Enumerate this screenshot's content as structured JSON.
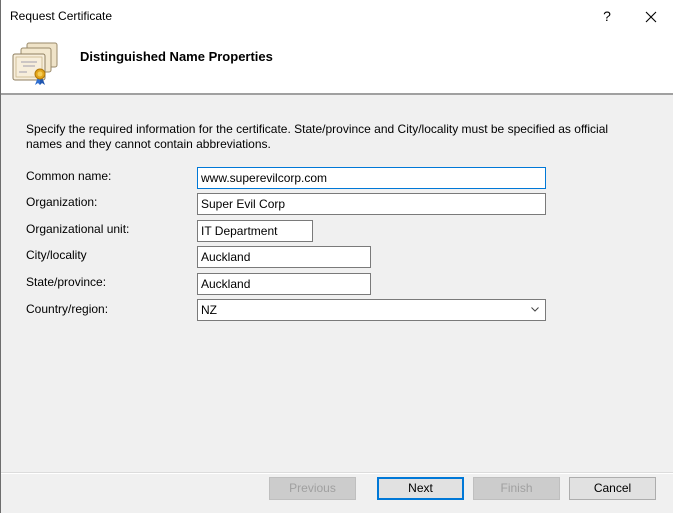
{
  "window": {
    "title": "Request Certificate",
    "help_label": "?",
    "close_label": "✕"
  },
  "header": {
    "icon": "certificates-icon",
    "title": "Distinguished Name Properties"
  },
  "instructions": "Specify the required information for the certificate. State/province and City/locality must be specified as official names and they cannot contain abbreviations.",
  "form": {
    "common_name": {
      "label": "Common name:",
      "value": "www.superevilcorp.com"
    },
    "organization": {
      "label": "Organization:",
      "value": "Super Evil Corp"
    },
    "organizational_unit": {
      "label": "Organizational unit:",
      "value": "IT Department"
    },
    "city": {
      "label": "City/locality",
      "value": "Auckland"
    },
    "state": {
      "label": "State/province:",
      "value": "Auckland"
    },
    "country": {
      "label": "Country/region:",
      "value": "NZ"
    }
  },
  "buttons": {
    "previous": "Previous",
    "next": "Next",
    "finish": "Finish",
    "cancel": "Cancel"
  },
  "colors": {
    "focus_accent": "#0078d7",
    "dialog_bg": "#f0f0f0"
  }
}
